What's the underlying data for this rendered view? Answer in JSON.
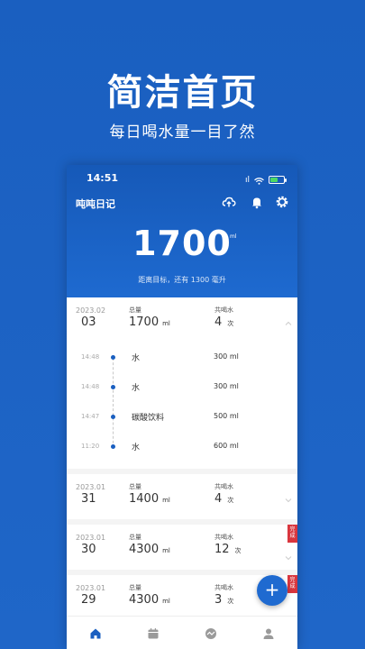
{
  "promo": {
    "title": "简洁首页",
    "subtitle": "每日喝水量一目了然"
  },
  "status_bar": {
    "time": "14:51",
    "signal": "ıl"
  },
  "header": {
    "app_title": "吨吨日记",
    "icons": [
      "cloud-upload-icon",
      "bell-icon",
      "gear-icon"
    ],
    "total_value": "1700",
    "total_unit": "ml",
    "remaining_text": "距离目标，还有 1300 毫升"
  },
  "colors": {
    "primary": "#1a5fc0",
    "badge": "#d9363e",
    "battery": "#4cd964"
  },
  "days": [
    {
      "year_month": "2023.02",
      "day": "03",
      "total_label": "总量",
      "total": "1700",
      "total_unit": "ml",
      "count_label": "共喝水",
      "count": "4",
      "count_unit": "次",
      "expanded": true,
      "badge": "",
      "entries": [
        {
          "time": "14:48",
          "name": "水",
          "amount": "300 ml"
        },
        {
          "time": "14:48",
          "name": "水",
          "amount": "300 ml"
        },
        {
          "time": "14:47",
          "name": "碳酸饮料",
          "amount": "500 ml"
        },
        {
          "time": "11:20",
          "name": "水",
          "amount": "600 ml"
        }
      ]
    },
    {
      "year_month": "2023.01",
      "day": "31",
      "total_label": "总量",
      "total": "1400",
      "total_unit": "ml",
      "count_label": "共喝水",
      "count": "4",
      "count_unit": "次",
      "expanded": false,
      "badge": ""
    },
    {
      "year_month": "2023.01",
      "day": "30",
      "total_label": "总量",
      "total": "4300",
      "total_unit": "ml",
      "count_label": "共喝水",
      "count": "12",
      "count_unit": "次",
      "expanded": false,
      "badge": "完成"
    },
    {
      "year_month": "2023.01",
      "day": "29",
      "total_label": "总量",
      "total": "4300",
      "total_unit": "ml",
      "count_label": "共喝水",
      "count": "3",
      "count_unit": "次",
      "expanded": false,
      "badge": "完成"
    }
  ],
  "fab": {
    "label": "+"
  },
  "tabbar": {
    "items": [
      "home-icon",
      "calendar-icon",
      "stats-icon",
      "profile-icon"
    ]
  }
}
